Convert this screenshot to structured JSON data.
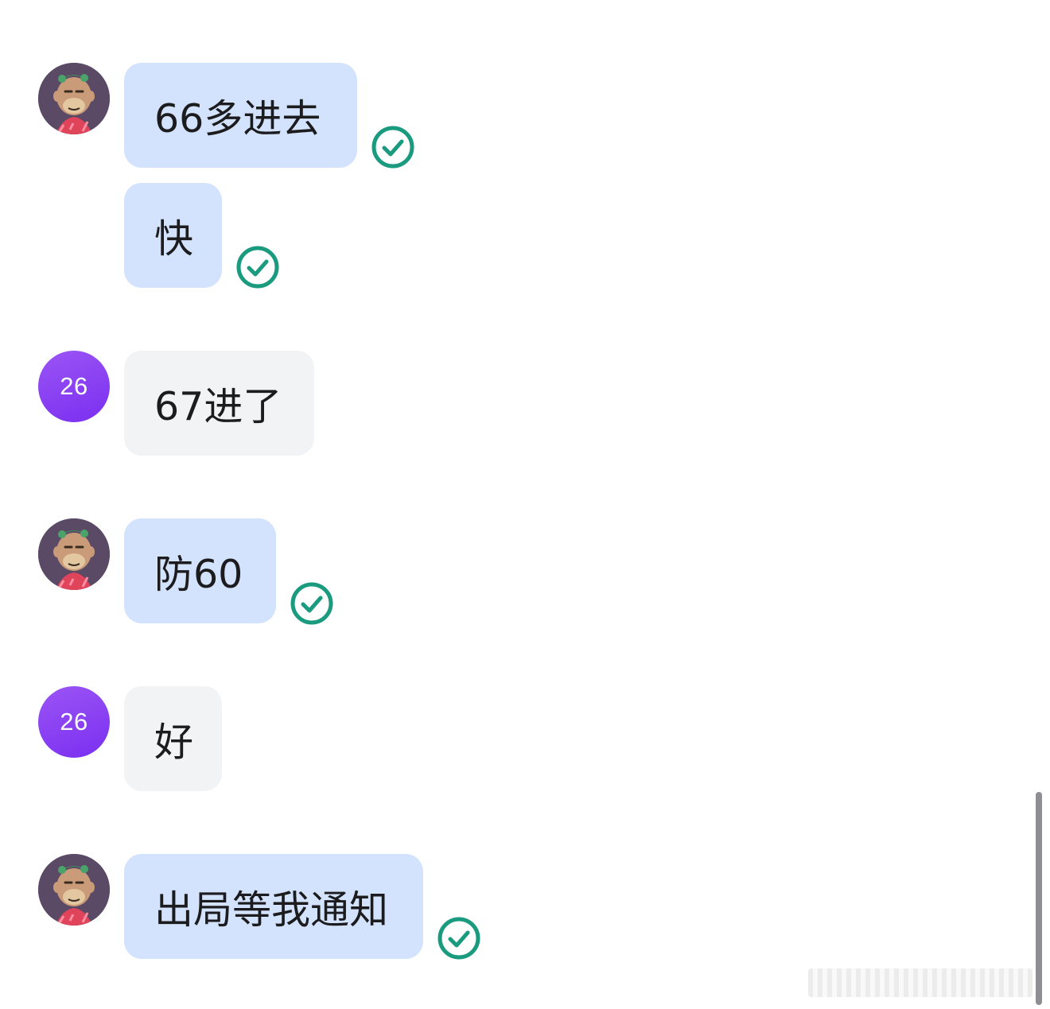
{
  "messages": [
    {
      "sender": "ape",
      "text": "66多进去",
      "status": "read"
    },
    {
      "sender": "ape",
      "text": "快",
      "status": "read"
    },
    {
      "sender": "26",
      "text": "67进了"
    },
    {
      "sender": "ape",
      "text": "防60",
      "status": "read"
    },
    {
      "sender": "26",
      "text": "好"
    },
    {
      "sender": "ape",
      "text": "出局等我通知",
      "status": "read"
    }
  ],
  "avatars": {
    "contact_initials": "26",
    "self_avatar_icon": "ape-avatar-icon"
  },
  "colors": {
    "outgoing_bubble": "#d3e3fd",
    "incoming_bubble": "#f2f3f5",
    "contact_avatar": "#8a3ff3",
    "read_check": "#1a9a7e"
  }
}
